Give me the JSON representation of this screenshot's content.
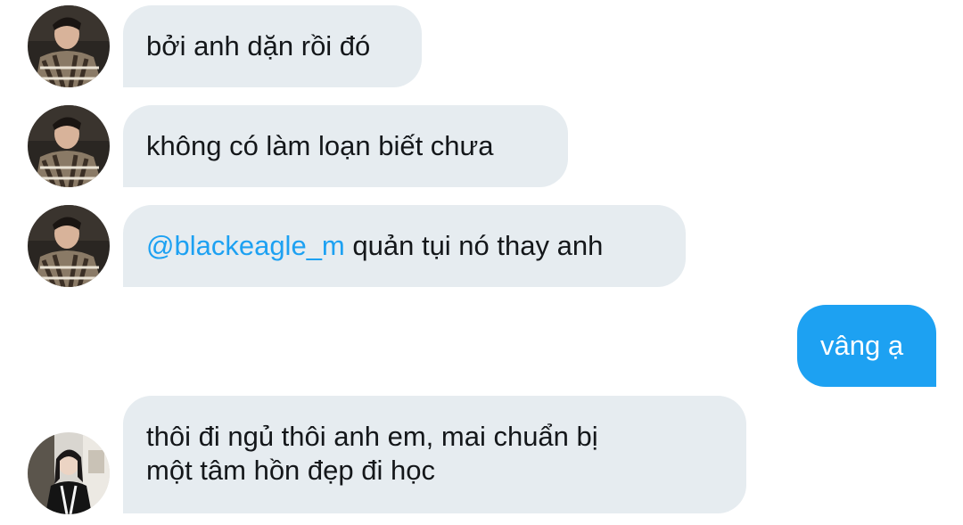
{
  "messages": [
    {
      "side": "incoming",
      "avatar": "male-avatar",
      "text": "bởi anh dặn rồi đó"
    },
    {
      "side": "incoming",
      "avatar": "male-avatar",
      "text": "không có làm loạn biết chưa"
    },
    {
      "side": "incoming",
      "avatar": "male-avatar",
      "mention": "@blackeagle_m",
      "text": " quản tụi nó thay anh"
    },
    {
      "side": "outgoing",
      "text": "vâng ạ"
    },
    {
      "side": "incoming",
      "avatar": "female-avatar",
      "lines": [
        "thôi đi ngủ thôi anh em, mai chuẩn bị",
        "một tâm hồn đẹp đi học"
      ]
    }
  ],
  "colors": {
    "incoming_bubble": "#e6ecf0",
    "outgoing_bubble": "#1da1f2",
    "mention": "#1da1f2",
    "text": "#14171a"
  }
}
